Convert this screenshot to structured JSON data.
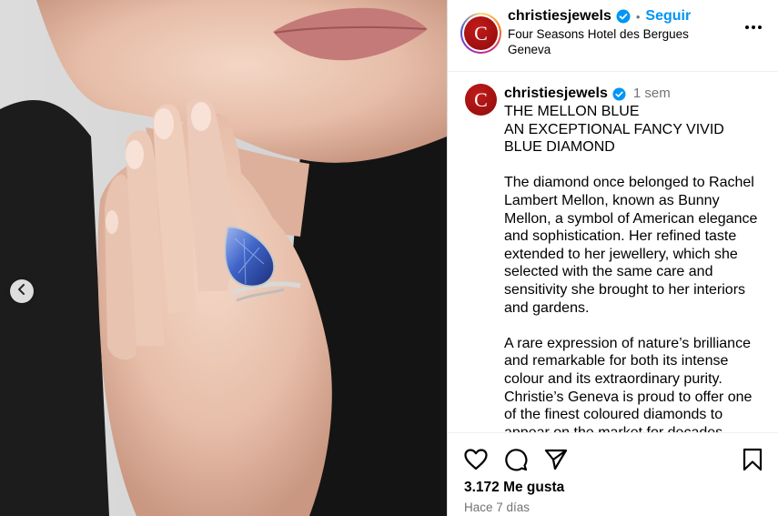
{
  "post": {
    "author": "christiesjewels",
    "avatar_letter": "C",
    "follow_label": "Seguir",
    "location": "Four Seasons Hotel des Bergues Geneva",
    "caption_age": "1 sem",
    "caption_paragraphs": [
      "THE MELLON BLUE\nAN EXCEPTIONAL FANCY VIVID BLUE DIAMOND",
      "The diamond once belonged to Rachel Lambert Mellon, known as Bunny Mellon, a symbol of American elegance and sophistication. Her refined taste extended to her jewellery, which she selected with the same care and sensitivity she brought to her interiors and gardens.",
      "A rare expression of nature’s brilliance and remarkable for both its intense colour and its extraordinary purity. Christie’s Geneva is proud to offer one of the finest coloured diamonds to appear on the market for decades."
    ],
    "likes": "3.172 Me gusta",
    "posted": "Hace 7 días"
  },
  "icons": {
    "verified": "verified-badge-icon",
    "more": "more-options-icon",
    "prev": "chevron-left-icon",
    "like": "heart-icon",
    "comment": "comment-icon",
    "share": "share-icon",
    "save": "bookmark-icon"
  },
  "colors": {
    "accent_blue": "#0095f6",
    "verified_blue": "#0095f6",
    "brand_red": "#a3111a",
    "muted_text": "#737373"
  }
}
